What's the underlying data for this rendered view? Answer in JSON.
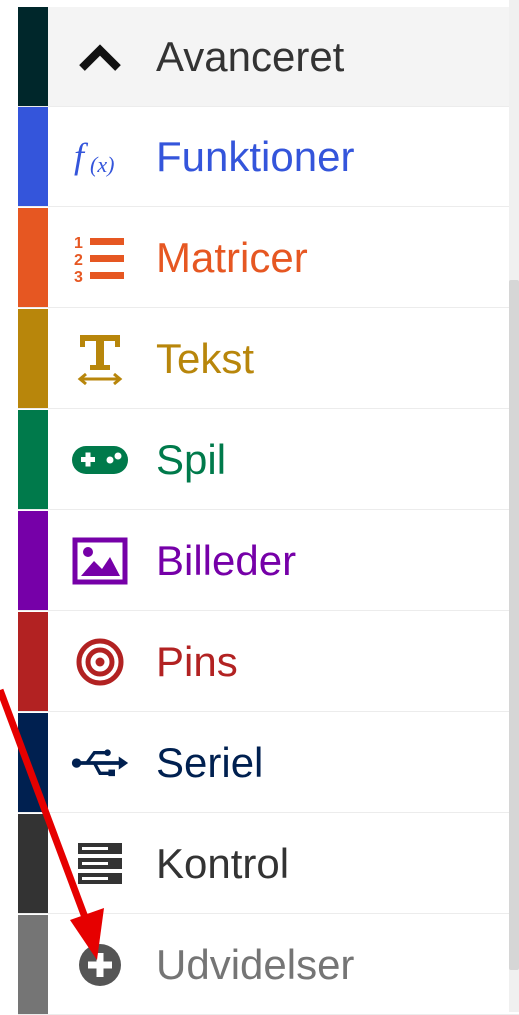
{
  "menu": {
    "items": [
      {
        "label": "Avanceret",
        "icon": "chevron-up-icon",
        "color": "#333333",
        "stripe": "#00272b"
      },
      {
        "label": "Funktioner",
        "icon": "function-icon",
        "color": "#3455db",
        "stripe": "#3455db"
      },
      {
        "label": "Matricer",
        "icon": "numbered-list-icon",
        "color": "#e65722",
        "stripe": "#e65722"
      },
      {
        "label": "Tekst",
        "icon": "text-width-icon",
        "color": "#b8860b",
        "stripe": "#b8860b"
      },
      {
        "label": "Spil",
        "icon": "gamepad-icon",
        "color": "#007a4b",
        "stripe": "#007a4b"
      },
      {
        "label": "Billeder",
        "icon": "image-icon",
        "color": "#7600a8",
        "stripe": "#7600a8"
      },
      {
        "label": "Pins",
        "icon": "target-icon",
        "color": "#b22222",
        "stripe": "#b22222"
      },
      {
        "label": "Seriel",
        "icon": "usb-icon",
        "color": "#002050",
        "stripe": "#002050"
      },
      {
        "label": "Kontrol",
        "icon": "server-icon",
        "color": "#333333",
        "stripe": "#333333"
      },
      {
        "label": "Udvidelser",
        "icon": "plus-circle-icon",
        "color": "#757575",
        "stripe": "#757575"
      }
    ]
  },
  "annotation": {
    "arrow_color": "#e60000"
  }
}
